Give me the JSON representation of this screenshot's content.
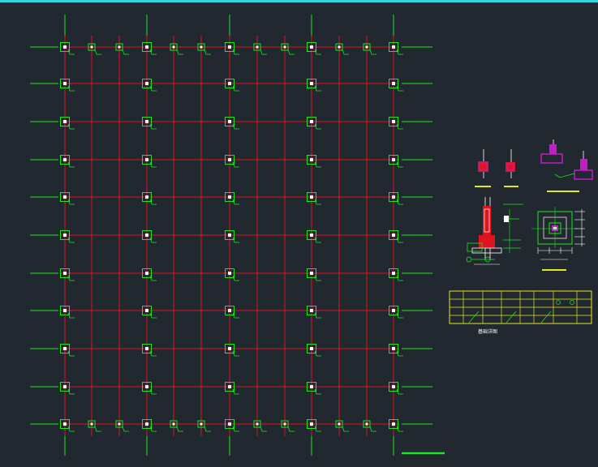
{
  "colors": {
    "background": "#212830",
    "top_border": "#2fd8d8",
    "beam_red": "#e0141e",
    "axis_green": "#1ee61e",
    "column_fill": "#ffffff",
    "detail_red": "#e0141e",
    "detail_magenta": "#c21ec8",
    "detail_yellow": "#e6e61e",
    "detail_cyan": "#2fd8d8"
  },
  "drawing": {
    "grid_columns": 12,
    "grid_rows": 11,
    "main_axis_columns": [
      1,
      4,
      7,
      10,
      13
    ],
    "edge_rows_all_columns": true
  },
  "table": {
    "caption": "基础详图"
  },
  "icons": {
    "column_marker": "square-column-icon",
    "axis_tick": "axis-tick-icon"
  }
}
